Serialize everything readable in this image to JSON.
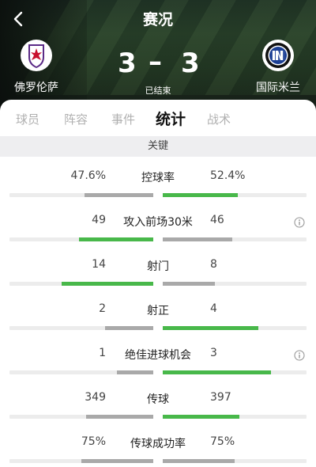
{
  "header": {
    "title": "赛况",
    "status": "已结束",
    "home": {
      "name": "佛罗伦萨",
      "score": "3",
      "logo": "fiorentina-logo"
    },
    "away": {
      "name": "国际米兰",
      "score": "3",
      "logo": "inter-logo"
    },
    "dash": "–"
  },
  "tabs": [
    {
      "label": "球员",
      "active": false
    },
    {
      "label": "阵容",
      "active": false
    },
    {
      "label": "事件",
      "active": false
    },
    {
      "label": "统计",
      "active": true
    },
    {
      "label": "战术",
      "active": false
    }
  ],
  "section": {
    "label": "关键"
  },
  "stats": [
    {
      "label": "控球率",
      "home": "47.6%",
      "away": "52.4%",
      "home_share": 0.476,
      "away_share": 0.524,
      "info": false
    },
    {
      "label": "攻入前场30米",
      "home": "49",
      "away": "46",
      "home_share": 0.516,
      "away_share": 0.484,
      "info": true
    },
    {
      "label": "射门",
      "home": "14",
      "away": "8",
      "home_share": 0.636,
      "away_share": 0.364,
      "info": false
    },
    {
      "label": "射正",
      "home": "2",
      "away": "4",
      "home_share": 0.333,
      "away_share": 0.667,
      "info": false
    },
    {
      "label": "绝佳进球机会",
      "home": "1",
      "away": "3",
      "home_share": 0.25,
      "away_share": 0.75,
      "info": true
    },
    {
      "label": "传球",
      "home": "349",
      "away": "397",
      "home_share": 0.468,
      "away_share": 0.532,
      "info": false
    },
    {
      "label": "传球成功率",
      "home": "75%",
      "away": "75%",
      "home_share": 0.5,
      "away_share": 0.5,
      "info": false
    }
  ],
  "colors": {
    "leader": "#48b84a",
    "other": "#a9a9a9",
    "track": "#ececec"
  }
}
